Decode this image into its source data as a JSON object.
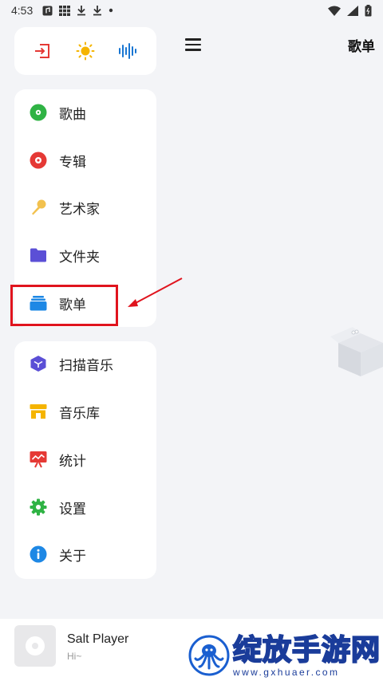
{
  "status_bar": {
    "time": "4:53",
    "left_icons": [
      "music-app-icon",
      "grid-icon",
      "download-icon",
      "download-icon",
      "dot-icon"
    ],
    "right_icons": [
      "wifi-icon",
      "signal-icon",
      "battery-icon"
    ]
  },
  "header": {
    "title": "歌单"
  },
  "quick_actions": [
    {
      "icon": "exit-icon",
      "color": "#e53935"
    },
    {
      "icon": "sun-icon",
      "color": "#f5b400"
    },
    {
      "icon": "waveform-icon",
      "color": "#1976d2"
    }
  ],
  "library_menu": [
    {
      "label": "歌曲",
      "icon": "song-disc-icon",
      "color": "#2fb344"
    },
    {
      "label": "专辑",
      "icon": "album-disc-icon",
      "color": "#e53935"
    },
    {
      "label": "艺术家",
      "icon": "microphone-icon",
      "color": "#f2c14e"
    },
    {
      "label": "文件夹",
      "icon": "folder-icon",
      "color": "#5b4fd6"
    },
    {
      "label": "歌单",
      "icon": "playlist-icon",
      "color": "#1e88e5"
    }
  ],
  "tools_menu": [
    {
      "label": "扫描音乐",
      "icon": "scan-cube-icon",
      "color": "#5b4fd6"
    },
    {
      "label": "音乐库",
      "icon": "store-icon",
      "color": "#f5b400"
    },
    {
      "label": "统计",
      "icon": "chart-board-icon",
      "color": "#e53935"
    },
    {
      "label": "设置",
      "icon": "gear-icon",
      "color": "#2fb344"
    },
    {
      "label": "关于",
      "icon": "info-icon",
      "color": "#1e88e5"
    }
  ],
  "player": {
    "title": "Salt Player",
    "artist": "Hi~"
  },
  "watermark": {
    "text": "绽放手游网",
    "url": "www.gxhuaer.com"
  }
}
